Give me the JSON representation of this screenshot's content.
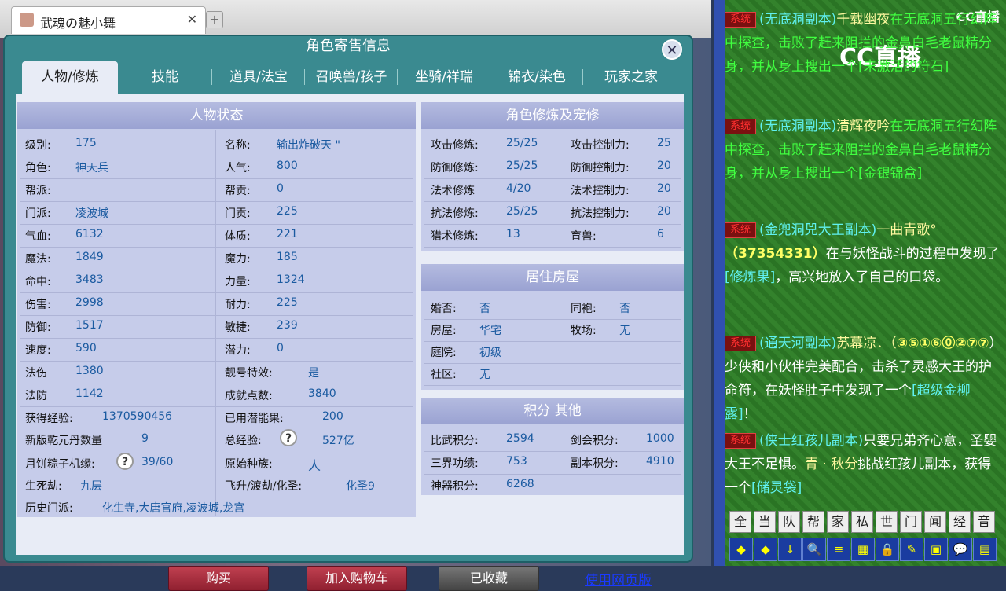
{
  "browser": {
    "tab_title": "武魂の魅小舞",
    "tab_close": "✕",
    "new_tab": "+"
  },
  "panel": {
    "title": "角色寄售信息",
    "close": "✕",
    "tabs": [
      "人物/修炼",
      "技能",
      "道具/法宝",
      "召唤兽/孩子",
      "坐骑/祥瑞",
      "锦衣/染色",
      "玩家之家"
    ],
    "active_tab": 0
  },
  "status": {
    "heading": "人物状态",
    "left_col": [
      {
        "label": "级别:",
        "value": "175"
      },
      {
        "label": "角色:",
        "value": "神天兵"
      },
      {
        "label": "帮派:",
        "value": ""
      },
      {
        "label": "门派:",
        "value": "凌波城"
      },
      {
        "label": "气血:",
        "value": "6132"
      },
      {
        "label": "魔法:",
        "value": "1849"
      },
      {
        "label": "命中:",
        "value": "3483"
      },
      {
        "label": "伤害:",
        "value": "2998"
      },
      {
        "label": "防御:",
        "value": "1517"
      },
      {
        "label": "速度:",
        "value": "590"
      },
      {
        "label": "法伤",
        "value": "1380"
      },
      {
        "label": "法防",
        "value": "1142"
      }
    ],
    "right_col": [
      {
        "label": "名称:",
        "value": "输出炸破天 \""
      },
      {
        "label": "人气:",
        "value": "800"
      },
      {
        "label": "帮贡:",
        "value": "0"
      },
      {
        "label": "门贡:",
        "value": "225"
      },
      {
        "label": "体质:",
        "value": "221"
      },
      {
        "label": "魔力:",
        "value": "185"
      },
      {
        "label": "力量:",
        "value": "1324"
      },
      {
        "label": "耐力:",
        "value": "225"
      },
      {
        "label": "敏捷:",
        "value": "239"
      },
      {
        "label": "潜力:",
        "value": "0"
      },
      {
        "label": "靓号特效:",
        "value": "是"
      },
      {
        "label": "成就点数:",
        "value": "3840"
      }
    ],
    "exp_label": "获得经验:",
    "exp_value": "1370590456",
    "used_fruit_label": "已用潜能果:",
    "used_fruit_value": "200",
    "qianyuan_label": "新版乾元丹数量",
    "qianyuan_value": "9",
    "total_exp_label": "总经验:",
    "total_exp_value": "527亿",
    "mooncake_label": "月饼粽子机缘:",
    "mooncake_value": "39/60",
    "race_label": "原始种族:",
    "race_value": "人",
    "life_label": "生死劫:",
    "life_value": "九层",
    "ascend_label": "飞升/渡劫/化圣:",
    "ascend_value": "化圣9",
    "history_label": "历史门派:",
    "history_value": "化生寺,大唐官府,凌波城,龙宫",
    "help_icon": "?"
  },
  "cultivation": {
    "heading": "角色修炼及宠修",
    "rows": [
      {
        "l1": "攻击修炼:",
        "v1": "25/25",
        "l2": "攻击控制力:",
        "v2": "25"
      },
      {
        "l1": "防御修炼:",
        "v1": "25/25",
        "l2": "防御控制力:",
        "v2": "20"
      },
      {
        "l1": "法术修炼",
        "v1": "4/20",
        "l2": "法术控制力:",
        "v2": "20"
      },
      {
        "l1": "抗法修炼:",
        "v1": "25/25",
        "l2": "抗法控制力:",
        "v2": "20"
      },
      {
        "l1": "猎术修炼:",
        "v1": "13",
        "l2": "育兽:",
        "v2": "6"
      }
    ]
  },
  "house": {
    "heading": "居住房屋",
    "rows": [
      {
        "l1": "婚否:",
        "v1": "否",
        "l2": "同袍:",
        "v2": "否"
      },
      {
        "l1": "房屋:",
        "v1": "华宅",
        "l2": "牧场:",
        "v2": "无"
      },
      {
        "l1": "庭院:",
        "v1": "初级",
        "l2": "",
        "v2": ""
      },
      {
        "l1": "社区:",
        "v1": "无",
        "l2": "",
        "v2": ""
      }
    ]
  },
  "points": {
    "heading": "积分 其他",
    "rows": [
      {
        "l1": "比武积分:",
        "v1": "2594",
        "l2": "剑会积分:",
        "v2": "1000"
      },
      {
        "l1": "三界功绩:",
        "v1": "753",
        "l2": "副本积分:",
        "v2": "4910"
      },
      {
        "l1": "神器积分:",
        "v1": "6268",
        "l2": "",
        "v2": ""
      }
    ]
  },
  "buttons": {
    "buy": "购买",
    "cart": "加入购物车",
    "collected": "已收藏",
    "web": "使用网页版"
  },
  "chat": {
    "logo": "CC直播",
    "logo_small": "CC直播",
    "sys_tag": "系统",
    "messages": [
      {
        "dungeon": "(无底洞副本)",
        "text1": "千载幽夜",
        "text2": "在无底洞五行幻阵中探查，击败了赶来阻拦的金鼻白毛老鼠精分身，并从身上搜出一个",
        "item": "[未激活的符石]"
      },
      {
        "dungeon": "(无底洞副本)",
        "text1": "清辉夜吟",
        "text2": "在无底洞五行幻阵中探查，击败了赶来阻拦的金鼻白毛老鼠精分身，并从身上搜出一个",
        "item": "[金银锦盒]"
      },
      {
        "dungeon": "(金兜洞兕大王副本)",
        "text1": "一曲青歌°",
        "numbers": "（37354331）",
        "text2": "在与妖怪战斗的过程中发现了",
        "item": "[修炼果]",
        "text3": "，高兴地放入了自己的口袋。"
      },
      {
        "dungeon": "(通天河副本)",
        "text1": "苏幕凉．（",
        "numbers": "③⑤①⑥⓪②⑦⑦",
        "text2": "）少侠和小伙伴完美配合，击杀了灵感大王的护命符，在妖怪肚子中发现了一个",
        "item": "[超级金柳露]",
        "text3": "！"
      },
      {
        "dungeon": "(侠士红孩儿副本)",
        "text1": "只要兄弟齐心意，圣婴大王不足惧。",
        "name": "青 · 秋分",
        "text2": "挑战红孩儿副本，获得一个",
        "item": "[储灵袋]"
      }
    ],
    "channels": [
      "全",
      "当",
      "队",
      "帮",
      "家",
      "私",
      "世",
      "门",
      "闻",
      "经",
      "音"
    ],
    "tools": [
      "◆",
      "◆",
      "↓",
      "🔍",
      "≡",
      "▦",
      "🔒",
      "✎",
      "▣",
      "💬",
      "▤"
    ]
  }
}
